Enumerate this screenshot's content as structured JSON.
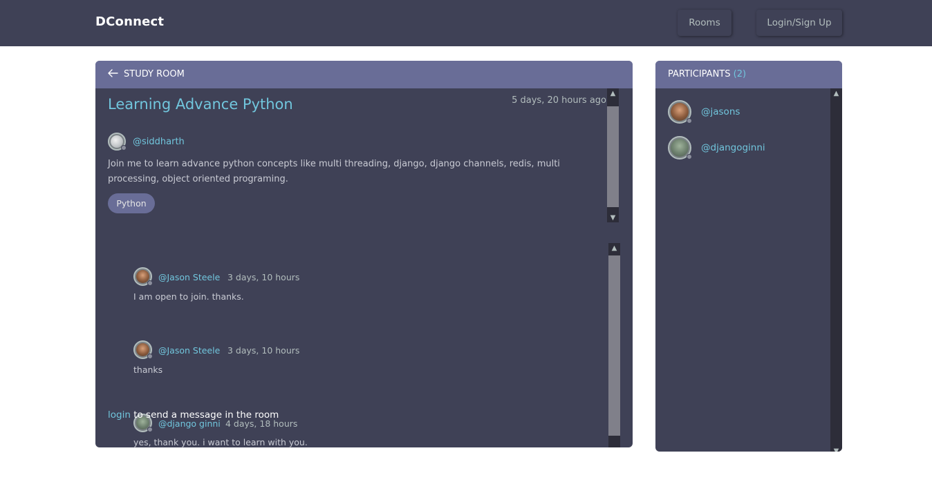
{
  "header": {
    "brand": "DConnect",
    "nav": {
      "rooms": "Rooms",
      "login_signup": "Login/Sign Up"
    }
  },
  "room": {
    "header_label": "STUDY ROOM",
    "title": "Learning Advance Python",
    "created": "5 days, 20 hours ago",
    "host": "@siddharth",
    "description": "Join me to learn advance python concepts like multi threading, django, django channels, redis, multi processing, object oriented programing.",
    "topic": "Python"
  },
  "messages": [
    {
      "user": "@Jason Steele",
      "time": "3 days, 10 hours",
      "text": "I am open to join. thanks."
    },
    {
      "user": "@Jason Steele",
      "time": "3 days, 10 hours",
      "text": "thanks"
    },
    {
      "user": "@django ginni",
      "time": "4 days, 18 hours",
      "text": "yes, thank you. i want to learn with you."
    }
  ],
  "login_prompt": {
    "link": "login",
    "text": "to send a message in the room"
  },
  "participants": {
    "title": "PARTICIPANTS",
    "count": "(2)",
    "list": [
      {
        "name": "@jasons"
      },
      {
        "name": "@djangoginni"
      }
    ]
  },
  "colors": {
    "navbar": "#3f4156",
    "panel": "#3f4156",
    "panel_header": "#696d97",
    "accent": "#71c6dd",
    "muted_text": "#b2bdbd"
  }
}
